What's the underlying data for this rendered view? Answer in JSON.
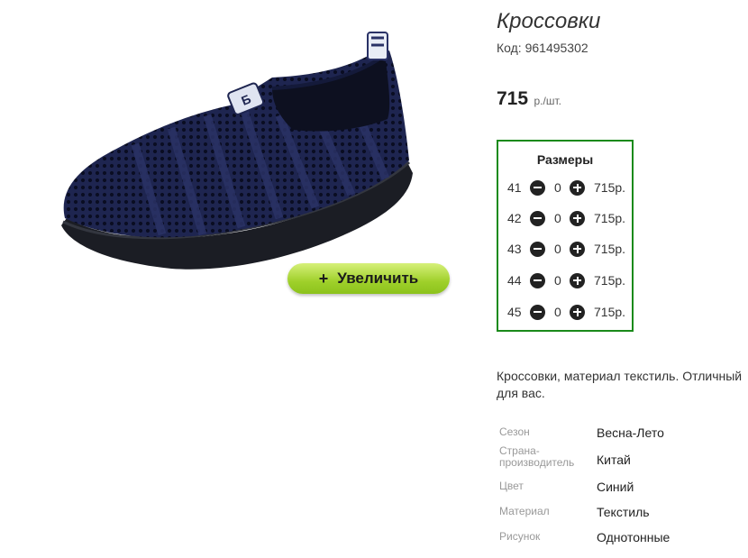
{
  "product": {
    "title": "Кроссовки",
    "code": "Код: 961495302",
    "price_amount": "715",
    "price_unit": "р./шт.",
    "description": "Кроссовки, материал текстиль. Отличный для вас."
  },
  "zoom_button": {
    "icon": "plus",
    "label": "Увеличить"
  },
  "sizes": {
    "title": "Размеры",
    "rows": [
      {
        "size": "41",
        "qty": "0",
        "price": "715р."
      },
      {
        "size": "42",
        "qty": "0",
        "price": "715р."
      },
      {
        "size": "43",
        "qty": "0",
        "price": "715р."
      },
      {
        "size": "44",
        "qty": "0",
        "price": "715р."
      },
      {
        "size": "45",
        "qty": "0",
        "price": "715р."
      }
    ]
  },
  "properties": [
    {
      "key": "Сезон",
      "value": "Весна-Лето"
    },
    {
      "key": "Страна-производитель",
      "value": "Китай"
    },
    {
      "key": "Цвет",
      "value": "Синий"
    },
    {
      "key": "Материал",
      "value": "Текстиль"
    },
    {
      "key": "Рисунок",
      "value": "Однотонные"
    }
  ],
  "colors": {
    "sizes_border": "#1a8a1a",
    "zoom_button": "#9fd02a",
    "shoe": "#1c2244"
  }
}
